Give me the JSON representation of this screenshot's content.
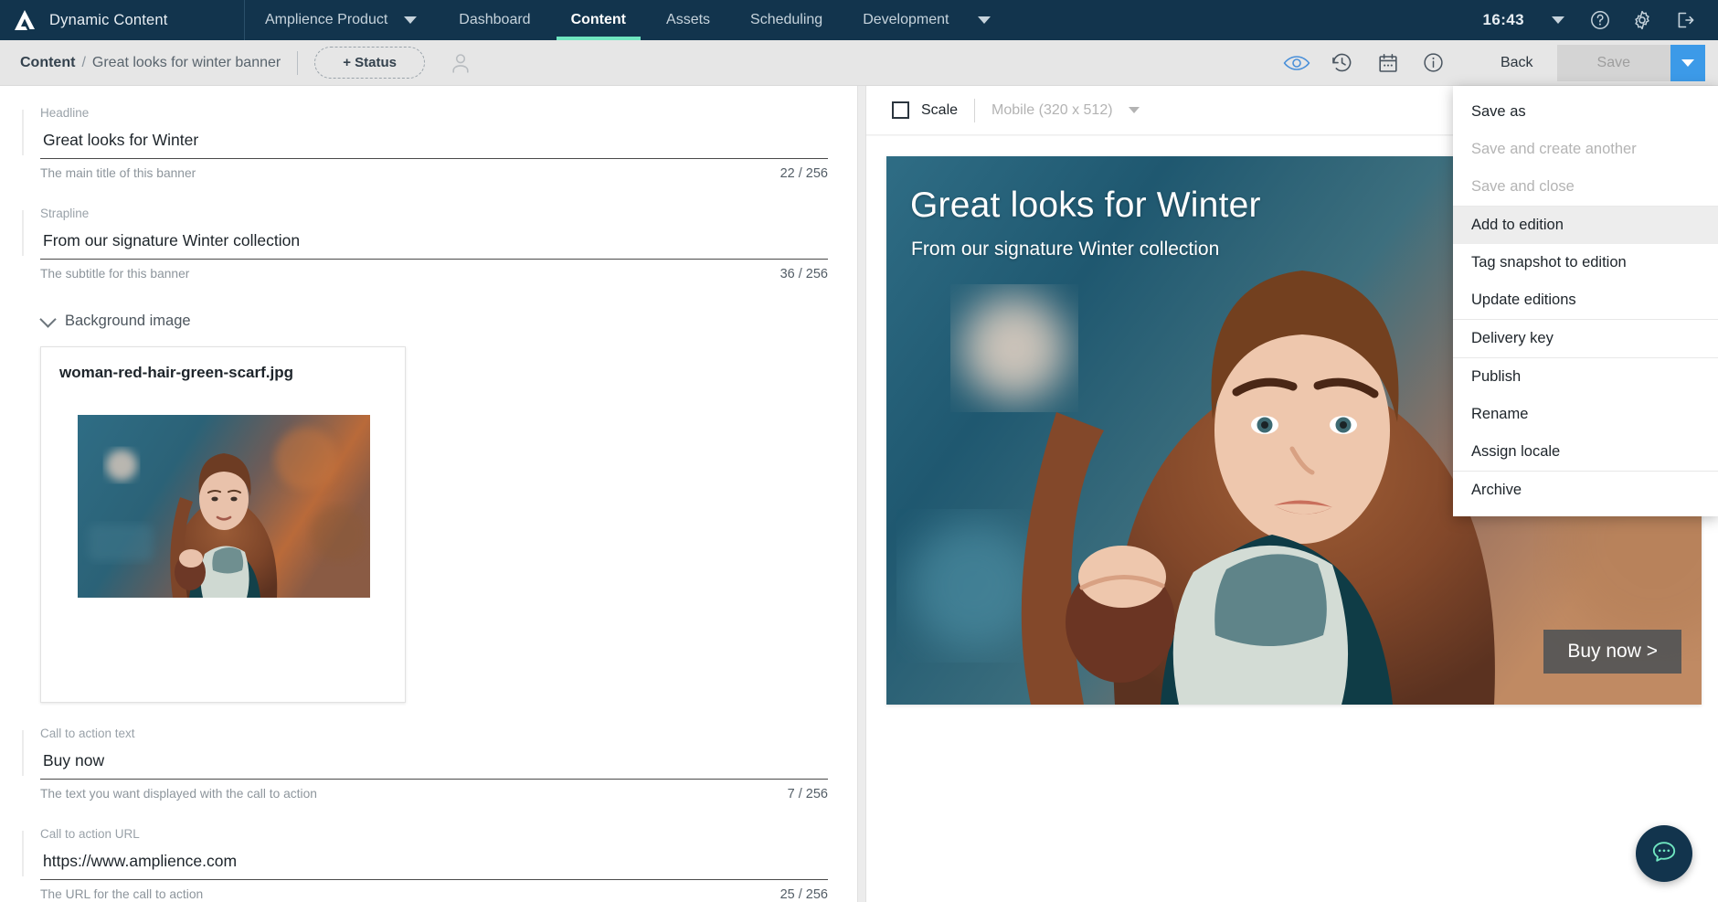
{
  "topnav": {
    "logo_icon": "amplience-logo-icon",
    "brand": "Dynamic Content",
    "product_switcher": {
      "label": "Amplience Product",
      "icon": "chevron-down-icon"
    },
    "tabs": [
      {
        "label": "Dashboard",
        "active": false
      },
      {
        "label": "Content",
        "active": true
      },
      {
        "label": "Assets",
        "active": false
      },
      {
        "label": "Scheduling",
        "active": false
      },
      {
        "label": "Development",
        "active": false
      }
    ],
    "more_icon": "chevron-down-icon",
    "clock": "16:43",
    "clock_caret_icon": "chevron-down-icon",
    "help_icon": "question-circle-icon",
    "settings_icon": "gear-icon",
    "logout_icon": "logout-icon",
    "accent_color": "#6fe5c0",
    "background_color": "#12344d"
  },
  "subheader": {
    "breadcrumb_root": "Content",
    "breadcrumb_separator": "/",
    "breadcrumb_leaf": "Great looks for winter banner",
    "status_button": "+ Status",
    "avatar_icon": "user-avatar-icon",
    "icons": [
      {
        "name": "preview-eye-icon",
        "color": "#4a90d9"
      },
      {
        "name": "history-clock-icon",
        "color": "#4a5560"
      },
      {
        "name": "calendar-icon",
        "color": "#4a5560"
      },
      {
        "name": "info-circle-icon",
        "color": "#4a5560"
      }
    ],
    "back_label": "Back",
    "save_label": "Save",
    "save_disabled": true,
    "save_caret_icon": "chevron-down-icon",
    "save_caret_color": "#3c9ae8"
  },
  "save_menu": {
    "groups": [
      {
        "items": [
          {
            "label": "Save as",
            "state": "enabled"
          },
          {
            "label": "Save and create another",
            "state": "disabled"
          },
          {
            "label": "Save and close",
            "state": "disabled"
          }
        ]
      },
      {
        "items": [
          {
            "label": "Add to edition",
            "state": "hovered"
          },
          {
            "label": "Tag snapshot to edition",
            "state": "enabled"
          },
          {
            "label": "Update editions",
            "state": "enabled"
          }
        ]
      },
      {
        "items": [
          {
            "label": "Delivery key",
            "state": "enabled"
          }
        ]
      },
      {
        "items": [
          {
            "label": "Publish",
            "state": "enabled"
          },
          {
            "label": "Rename",
            "state": "enabled"
          },
          {
            "label": "Assign locale",
            "state": "enabled"
          }
        ]
      },
      {
        "items": [
          {
            "label": "Archive",
            "state": "enabled"
          }
        ]
      }
    ]
  },
  "form": {
    "headline": {
      "label": "Headline",
      "value": "Great looks for Winter",
      "help": "The main title of this banner",
      "count": "22 / 256"
    },
    "strapline": {
      "label": "Strapline",
      "value": "From our signature Winter collection",
      "help": "The subtitle for this banner",
      "count": "36 / 256"
    },
    "background_image": {
      "section_title": "Background image",
      "collapse_icon": "chevron-down-icon",
      "asset_name": "woman-red-hair-green-scarf.jpg"
    },
    "cta_text": {
      "label": "Call to action text",
      "value": "Buy now",
      "help": "The text you want displayed with the call to action",
      "count": "7 / 256"
    },
    "cta_url": {
      "label": "Call to action URL",
      "value": "https://www.amplience.com",
      "help": "The URL for the call to action",
      "count": "25 / 256"
    }
  },
  "preview": {
    "scale_label": "Scale",
    "scale_checked": false,
    "device": "Mobile (320 x 512)",
    "device_caret_icon": "chevron-down-icon",
    "banner": {
      "headline": "Great looks for Winter",
      "strapline": "From our signature Winter collection",
      "cta": "Buy now >"
    }
  },
  "chat": {
    "icon": "chat-bubble-icon",
    "background_color": "#12344d",
    "icon_color": "#6fe5c0"
  }
}
